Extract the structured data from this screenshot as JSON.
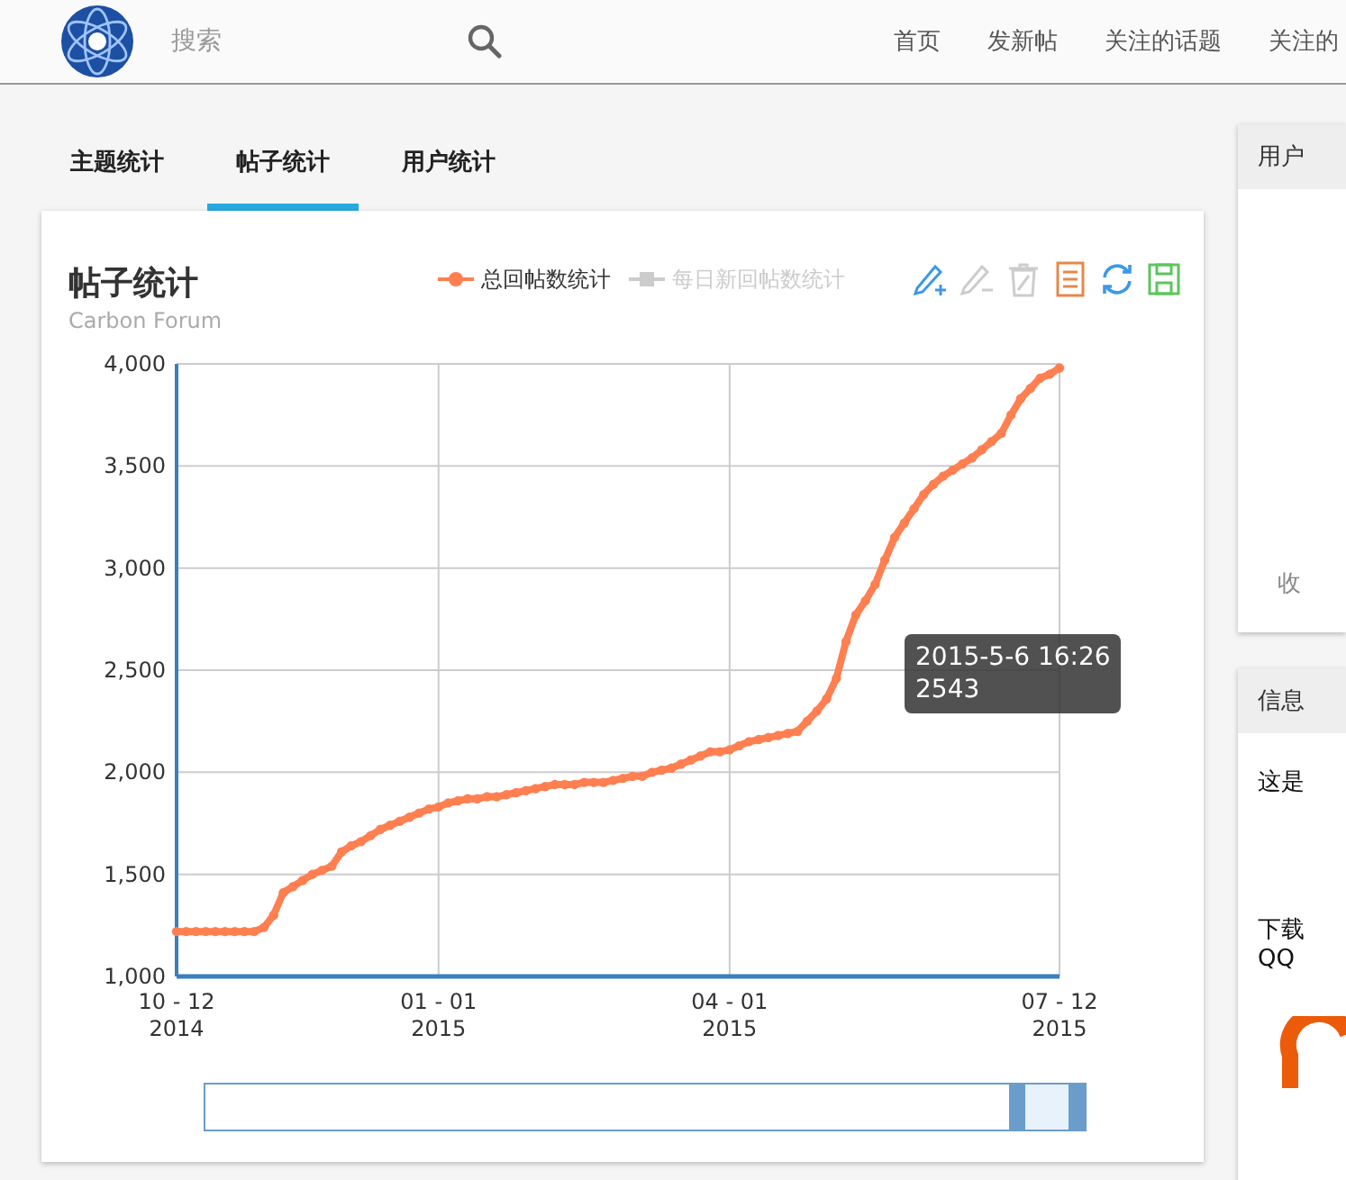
{
  "header": {
    "search": {
      "placeholder": "搜索"
    },
    "nav": [
      "首页",
      "发新帖",
      "关注的话题",
      "关注的"
    ]
  },
  "tabs": [
    {
      "label": "主题统计",
      "selected": false
    },
    {
      "label": "帖子统计",
      "selected": true
    },
    {
      "label": "用户统计",
      "selected": false
    }
  ],
  "card": {
    "title": "帖子统计",
    "subtitle": "Carbon Forum",
    "legend": [
      {
        "label": "每日新回帖数统计",
        "on": false
      }
    ],
    "toolbox": [
      {
        "kind": "mark",
        "disabled": false
      },
      {
        "kind": "unmark",
        "disabled": true
      },
      {
        "kind": "clear",
        "disabled": true
      },
      {
        "kind": "data",
        "disabled": false
      },
      {
        "kind": "refresh",
        "disabled": false
      },
      {
        "kind": "save",
        "disabled": false
      }
    ],
    "chart_data": {
      "type": "line",
      "categories": [
        "10 - 12 2014",
        null,
        null,
        null,
        null,
        null,
        null,
        null,
        null,
        null,
        null,
        null,
        null,
        null,
        null,
        null,
        null,
        null,
        null,
        null,
        null,
        null,
        null,
        null,
        null,
        null,
        null,
        "01 - 01 2015",
        null,
        null,
        null,
        null,
        null,
        null,
        null,
        null,
        null,
        null,
        null,
        null,
        null,
        null,
        null,
        null,
        null,
        null,
        null,
        null,
        null,
        null,
        null,
        null,
        null,
        null,
        null,
        null,
        null,
        "04 - 01 2015",
        null,
        null,
        null,
        null,
        null,
        null,
        null,
        null,
        null,
        null,
        null,
        null,
        null,
        null,
        null,
        null,
        null,
        null,
        null,
        null,
        null,
        null,
        null,
        null,
        null,
        null,
        null,
        null,
        null,
        null,
        null,
        null,
        null,
        "07 - 12 2015"
      ],
      "grid": true,
      "series": [
        {
          "name": "总回帖数统计",
          "color": "#ff7f50",
          "marker": "circle",
          "values": [
            1220,
            1220,
            1220,
            1220,
            1220,
            1220,
            1220,
            1220,
            1220,
            1240,
            1300,
            1410,
            1440,
            1470,
            1500,
            1520,
            1540,
            1610,
            1640,
            1660,
            1690,
            1720,
            1740,
            1760,
            1780,
            1800,
            1820,
            1830,
            1850,
            1860,
            1870,
            1870,
            1880,
            1880,
            1890,
            1900,
            1910,
            1920,
            1930,
            1940,
            1940,
            1940,
            1950,
            1950,
            1950,
            1960,
            1970,
            1980,
            1980,
            2000,
            2010,
            2020,
            2040,
            2060,
            2080,
            2100,
            2100,
            2110,
            2130,
            2150,
            2160,
            2170,
            2180,
            2190,
            2200,
            2250,
            2300,
            2360,
            2460,
            2640,
            2770,
            2840,
            2920,
            3040,
            3150,
            3220,
            3290,
            3360,
            3410,
            3450,
            3480,
            3510,
            3540,
            3580,
            3620,
            3660,
            3750,
            3830,
            3880,
            3930,
            3950,
            3980
          ]
        }
      ],
      "ylim": [
        1000,
        4000
      ],
      "yticks": [
        {
          "value": 1000,
          "label": "1,000"
        },
        {
          "value": 1500,
          "label": "1,500"
        },
        {
          "value": 2000,
          "label": "2,000"
        },
        {
          "value": 2500,
          "label": "2,500"
        },
        {
          "value": 3000,
          "label": "3,000"
        },
        {
          "value": 3500,
          "label": "3,500"
        },
        {
          "value": 4000,
          "label": "4,000"
        }
      ]
    },
    "tooltip": {
      "title": "2015-5-6 16:26",
      "value": "2543"
    }
  },
  "side_panels": [
    {
      "title": "用户",
      "footer": "收"
    },
    {
      "title": "信息",
      "lines": [
        "这是",
        "下载",
        "QQ"
      ]
    }
  ]
}
